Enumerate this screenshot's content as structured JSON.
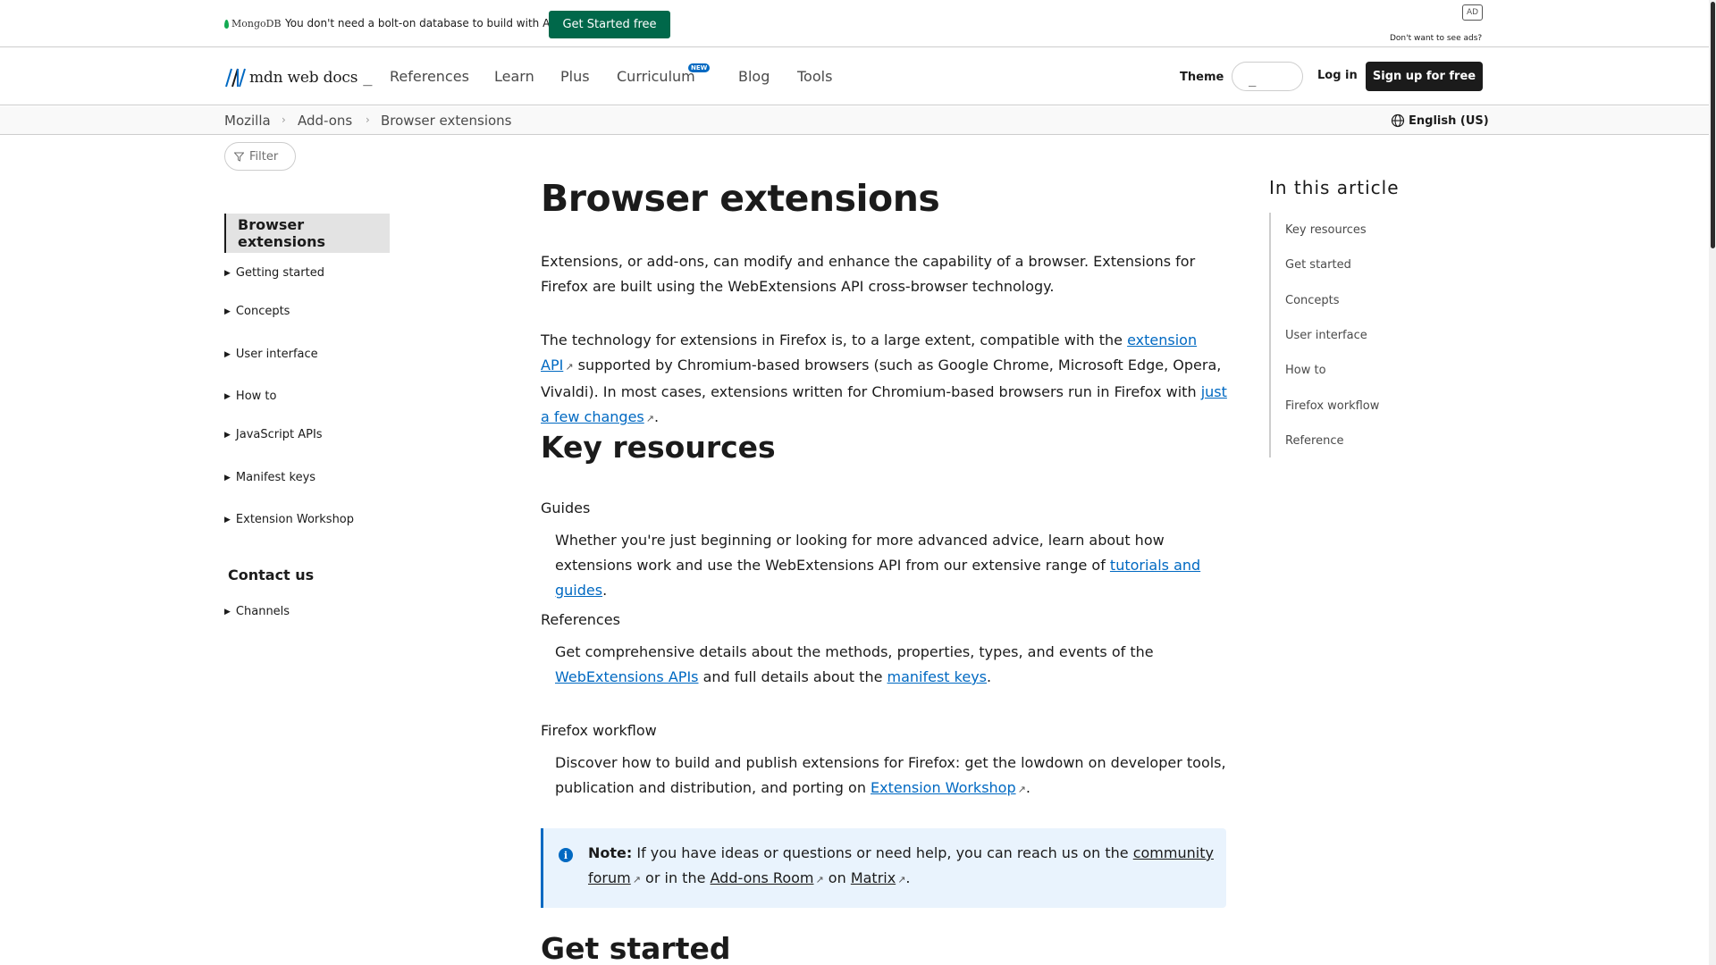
{
  "ad": {
    "brand": "MongoDB",
    "text": "You don't need a bolt-on database to build with AI",
    "cta": "Get Started free",
    "badge": "AD",
    "no_ads": "Don't want to see ads?",
    "brand_color": "#00684a"
  },
  "header": {
    "logo_text": "mdn web docs",
    "logo_cursor": "_",
    "nav": [
      "References",
      "Learn",
      "Plus",
      "Curriculum",
      "Blog",
      "Tools"
    ],
    "new_badge": "NEW",
    "theme_label": "Theme",
    "theme_value": "_",
    "login": "Log in",
    "signup": "Sign up for free"
  },
  "breadcrumb": [
    "Mozilla",
    "Add-ons",
    "Browser extensions"
  ],
  "language": "English (US)",
  "sidebar": {
    "filter": "Filter",
    "active": "Browser extensions",
    "items": [
      "Getting started",
      "Concepts",
      "User interface",
      "How to",
      "JavaScript APIs",
      "Manifest keys",
      "Extension Workshop"
    ],
    "contact_heading": "Contact us",
    "contact_items": [
      "Channels"
    ]
  },
  "article": {
    "title": "Browser extensions",
    "intro": "Extensions, or add-ons, can modify and enhance the capability of a browser. Extensions for Firefox are built using the WebExtensions API cross-browser technology.",
    "p2_a": "The technology for extensions in Firefox is, to a large extent, compatible with the ",
    "p2_link1": "extension API",
    "p2_b": " supported by Chromium-based browsers (such as Google Chrome, Microsoft Edge, Opera, Vivaldi). In most cases, extensions written for Chromium-based browsers run in Firefox with ",
    "p2_link2": "just a few changes",
    "p2_c": ".",
    "key_resources": "Key resources",
    "guides_term": "Guides",
    "guides_a": "Whether you're just beginning or looking for more advanced advice, learn about how extensions work and use the WebExtensions API from our extensive range of ",
    "guides_link": "tutorials and guides",
    "guides_b": ".",
    "refs_term": "References",
    "refs_a": "Get comprehensive details about the methods, properties, types, and events of the ",
    "refs_link1": "WebExtensions APIs",
    "refs_b": " and full details about the ",
    "refs_link2": "manifest keys",
    "refs_c": ".",
    "workflow_term": "Firefox workflow",
    "workflow_a": "Discover how to build and publish extensions for Firefox: get the lowdown on developer tools, publication and distribution, and porting on ",
    "workflow_link": "Extension Workshop",
    "workflow_b": ".",
    "note_label": "Note:",
    "note_a": " If you have ideas or questions or need help, you can reach us on the ",
    "note_link1": "community forum",
    "note_b": " or in the ",
    "note_link2": "Add-ons Room",
    "note_c": " on ",
    "note_link3": "Matrix",
    "note_d": ".",
    "get_started": "Get started"
  },
  "toc": {
    "title": "In this article",
    "items": [
      "Key resources",
      "Get started",
      "Concepts",
      "User interface",
      "How to",
      "Firefox workflow",
      "Reference"
    ]
  }
}
